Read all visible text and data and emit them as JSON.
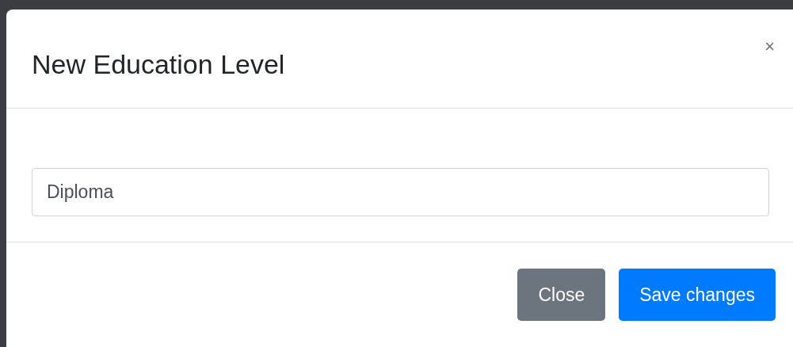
{
  "modal": {
    "title": "New Education Level",
    "close_icon": "×"
  },
  "field": {
    "value": "Diploma"
  },
  "buttons": [
    {
      "label": "Close",
      "kind": "secondary"
    },
    {
      "label": "Save changes",
      "kind": "primary"
    }
  ]
}
